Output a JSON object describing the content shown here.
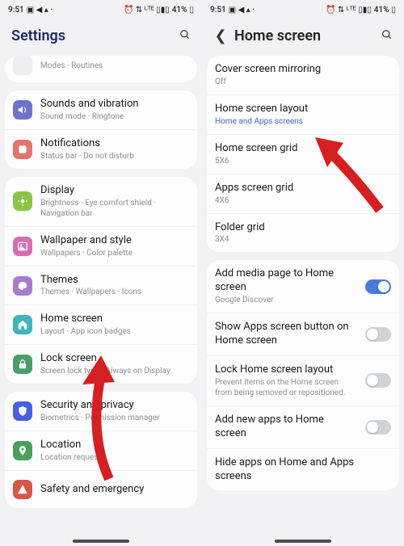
{
  "status": {
    "time": "9:51",
    "battery": "41%"
  },
  "left": {
    "title": "Settings",
    "groups": [
      {
        "partial_top": true,
        "rows": [
          {
            "icon_bg": "#ededf0",
            "icon_fg": "#888",
            "name": "modes-icon",
            "title": "",
            "sub": "Modes · Routines"
          }
        ]
      },
      {
        "rows": [
          {
            "icon_bg": "#6f72c9",
            "icon_fg": "#fff",
            "name": "sound-icon",
            "glyph": "vol",
            "title": "Sounds and vibration",
            "sub": "Sound mode · Ringtone"
          },
          {
            "icon_bg": "#e5746a",
            "icon_fg": "#fff",
            "name": "notif-icon",
            "glyph": "dot",
            "title": "Notifications",
            "sub": "Status bar · Do not disturb"
          }
        ]
      },
      {
        "rows": [
          {
            "icon_bg": "#8cc44a",
            "icon_fg": "#fff",
            "name": "display-icon",
            "glyph": "sun",
            "title": "Display",
            "sub": "Brightness · Eye comfort shield · Navigation bar"
          },
          {
            "icon_bg": "#d46eb4",
            "icon_fg": "#fff",
            "name": "wallpaper-icon",
            "glyph": "img",
            "title": "Wallpaper and style",
            "sub": "Wallpapers · Color palette"
          },
          {
            "icon_bg": "#a87bd0",
            "icon_fg": "#fff",
            "name": "themes-icon",
            "glyph": "pal",
            "title": "Themes",
            "sub": "Themes · Wallpapers · Icons"
          },
          {
            "icon_bg": "#3fb5b7",
            "icon_fg": "#fff",
            "name": "home-icon",
            "glyph": "home",
            "title": "Home screen",
            "sub": "Layout · App icon badges"
          },
          {
            "icon_bg": "#4a9e6a",
            "icon_fg": "#fff",
            "name": "lock-icon",
            "glyph": "lock",
            "title": "Lock screen",
            "sub": "Screen lock type · Always on Display"
          }
        ]
      },
      {
        "rows": [
          {
            "icon_bg": "#4a5edf",
            "icon_fg": "#fff",
            "name": "security-icon",
            "glyph": "shield",
            "title": "Security and privacy",
            "sub": "Biometrics · Permission manager"
          },
          {
            "icon_bg": "#4aa05a",
            "icon_fg": "#fff",
            "name": "location-icon",
            "glyph": "pin",
            "title": "Location",
            "sub": "Location requests"
          },
          {
            "icon_bg": "#d6574a",
            "icon_fg": "#fff",
            "name": "safety-icon",
            "glyph": "warn",
            "title": "Safety and emergency",
            "sub": ""
          }
        ]
      }
    ]
  },
  "right": {
    "title": "Home screen",
    "groups": [
      {
        "rows": [
          {
            "title": "Cover screen mirroring",
            "sub": "Off"
          },
          {
            "title": "Home screen layout",
            "sub": "Home and Apps screens",
            "sub_link": true
          },
          {
            "title": "Home screen grid",
            "sub": "5X6"
          },
          {
            "title": "Apps screen grid",
            "sub": "4X6"
          },
          {
            "title": "Folder grid",
            "sub": "3X4"
          }
        ]
      },
      {
        "rows": [
          {
            "title": "Add media page to Home screen",
            "sub": "Google Discover",
            "toggle": true,
            "toggle_on": true
          },
          {
            "title": "Show Apps screen button on Home screen",
            "toggle": true,
            "toggle_on": false
          },
          {
            "title": "Lock Home screen layout",
            "sub": "Prevent items on the Home screen from being removed or repositioned.",
            "toggle": true,
            "toggle_on": false
          },
          {
            "title": "Add new apps to Home screen",
            "toggle": true,
            "toggle_on": false
          },
          {
            "title": "Hide apps on Home and Apps screens"
          }
        ]
      }
    ]
  }
}
